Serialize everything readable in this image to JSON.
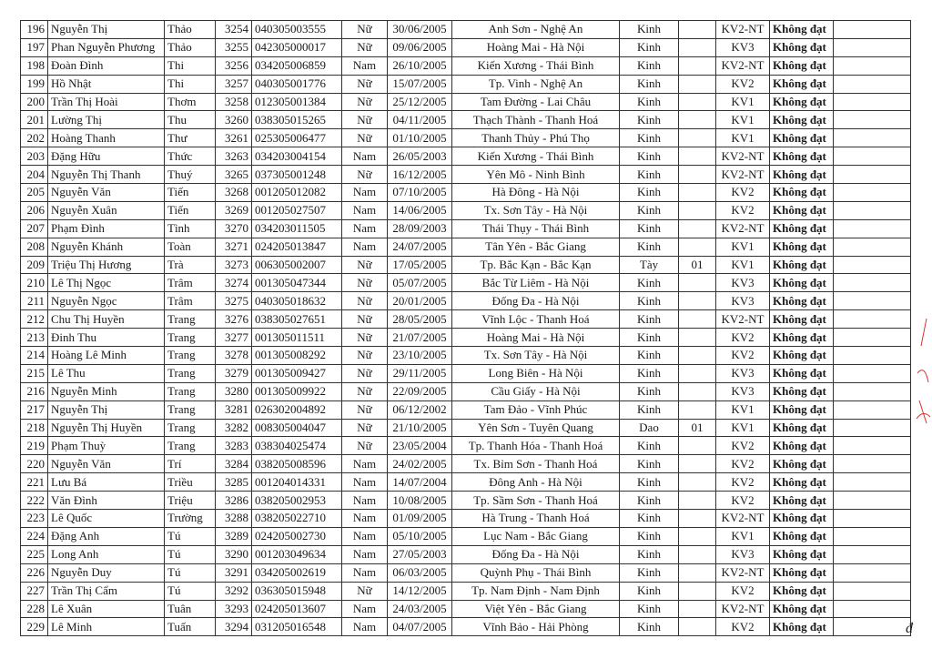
{
  "table": {
    "rows": [
      [
        "196",
        "Nguyễn Thị",
        "Thảo",
        "3254",
        "040305003555",
        "Nữ",
        "30/06/2005",
        "Anh Sơn - Nghệ An",
        "Kinh",
        "",
        "KV2-NT",
        "Không đạt",
        ""
      ],
      [
        "197",
        "Phan Nguyễn Phương",
        "Thảo",
        "3255",
        "042305000017",
        "Nữ",
        "09/06/2005",
        "Hoàng Mai - Hà Nội",
        "Kinh",
        "",
        "KV3",
        "Không đạt",
        ""
      ],
      [
        "198",
        "Đoàn Đình",
        "Thi",
        "3256",
        "034205006859",
        "Nam",
        "26/10/2005",
        "Kiến Xương - Thái Bình",
        "Kinh",
        "",
        "KV2-NT",
        "Không đạt",
        ""
      ],
      [
        "199",
        "Hồ Nhật",
        "Thi",
        "3257",
        "040305001776",
        "Nữ",
        "15/07/2005",
        "Tp. Vinh - Nghệ An",
        "Kinh",
        "",
        "KV2",
        "Không đạt",
        ""
      ],
      [
        "200",
        "Trần Thị Hoài",
        "Thơm",
        "3258",
        "012305001384",
        "Nữ",
        "25/12/2005",
        "Tam Đường - Lai Châu",
        "Kinh",
        "",
        "KV1",
        "Không đạt",
        ""
      ],
      [
        "201",
        "Lường Thị",
        "Thu",
        "3260",
        "038305015265",
        "Nữ",
        "04/11/2005",
        "Thạch Thành - Thanh Hoá",
        "Kinh",
        "",
        "KV1",
        "Không đạt",
        ""
      ],
      [
        "202",
        "Hoàng Thanh",
        "Thư",
        "3261",
        "025305006477",
        "Nữ",
        "01/10/2005",
        "Thanh Thủy - Phú Thọ",
        "Kinh",
        "",
        "KV1",
        "Không đạt",
        ""
      ],
      [
        "203",
        "Đặng Hữu",
        "Thức",
        "3263",
        "034203004154",
        "Nam",
        "26/05/2003",
        "Kiến Xương - Thái Bình",
        "Kinh",
        "",
        "KV2-NT",
        "Không đạt",
        ""
      ],
      [
        "204",
        "Nguyễn Thị Thanh",
        "Thuý",
        "3265",
        "037305001248",
        "Nữ",
        "16/12/2005",
        "Yên Mô - Ninh Bình",
        "Kinh",
        "",
        "KV2-NT",
        "Không đạt",
        ""
      ],
      [
        "205",
        "Nguyễn Văn",
        "Tiến",
        "3268",
        "001205012082",
        "Nam",
        "07/10/2005",
        "Hà Đông - Hà Nội",
        "Kinh",
        "",
        "KV2",
        "Không đạt",
        ""
      ],
      [
        "206",
        "Nguyễn Xuân",
        "Tiến",
        "3269",
        "001205027507",
        "Nam",
        "14/06/2005",
        "Tx. Sơn Tây - Hà Nội",
        "Kinh",
        "",
        "KV2",
        "Không đạt",
        ""
      ],
      [
        "207",
        "Phạm Đình",
        "Tình",
        "3270",
        "034203011505",
        "Nam",
        "28/09/2003",
        "Thái Thụy - Thái Bình",
        "Kinh",
        "",
        "KV2-NT",
        "Không đạt",
        ""
      ],
      [
        "208",
        "Nguyễn Khánh",
        "Toàn",
        "3271",
        "024205013847",
        "Nam",
        "24/07/2005",
        "Tân Yên - Bắc Giang",
        "Kinh",
        "",
        "KV1",
        "Không đạt",
        ""
      ],
      [
        "209",
        "Triệu Thị Hương",
        "Trà",
        "3273",
        "006305002007",
        "Nữ",
        "17/05/2005",
        "Tp. Bắc Kạn - Bắc Kạn",
        "Tày",
        "01",
        "KV1",
        "Không đạt",
        ""
      ],
      [
        "210",
        "Lê Thị Ngọc",
        "Trâm",
        "3274",
        "001305047344",
        "Nữ",
        "05/07/2005",
        "Bắc Từ Liêm - Hà Nội",
        "Kinh",
        "",
        "KV3",
        "Không đạt",
        ""
      ],
      [
        "211",
        "Nguyễn Ngọc",
        "Trâm",
        "3275",
        "040305018632",
        "Nữ",
        "20/01/2005",
        "Đống Đa - Hà Nội",
        "Kinh",
        "",
        "KV3",
        "Không đạt",
        ""
      ],
      [
        "212",
        "Chu Thị Huyền",
        "Trang",
        "3276",
        "038305027651",
        "Nữ",
        "28/05/2005",
        "Vĩnh Lộc - Thanh Hoá",
        "Kinh",
        "",
        "KV2-NT",
        "Không đạt",
        ""
      ],
      [
        "213",
        "Đinh Thu",
        "Trang",
        "3277",
        "001305011511",
        "Nữ",
        "21/07/2005",
        "Hoàng Mai - Hà Nội",
        "Kinh",
        "",
        "KV2",
        "Không đạt",
        ""
      ],
      [
        "214",
        "Hoàng Lê Minh",
        "Trang",
        "3278",
        "001305008292",
        "Nữ",
        "23/10/2005",
        "Tx. Sơn Tây - Hà Nội",
        "Kinh",
        "",
        "KV2",
        "Không đạt",
        ""
      ],
      [
        "215",
        "Lê Thu",
        "Trang",
        "3279",
        "001305009427",
        "Nữ",
        "29/11/2005",
        "Long Biên - Hà Nội",
        "Kinh",
        "",
        "KV3",
        "Không đạt",
        ""
      ],
      [
        "216",
        "Nguyễn Minh",
        "Trang",
        "3280",
        "001305009922",
        "Nữ",
        "22/09/2005",
        "Cầu Giấy - Hà Nội",
        "Kinh",
        "",
        "KV3",
        "Không đạt",
        ""
      ],
      [
        "217",
        "Nguyễn Thị",
        "Trang",
        "3281",
        "026302004892",
        "Nữ",
        "06/12/2002",
        "Tam Đảo - Vĩnh Phúc",
        "Kinh",
        "",
        "KV1",
        "Không đạt",
        ""
      ],
      [
        "218",
        "Nguyễn Thị Huyền",
        "Trang",
        "3282",
        "008305004047",
        "Nữ",
        "21/10/2005",
        "Yên Sơn - Tuyên Quang",
        "Dao",
        "01",
        "KV1",
        "Không đạt",
        ""
      ],
      [
        "219",
        "Phạm Thuỳ",
        "Trang",
        "3283",
        "038304025474",
        "Nữ",
        "23/05/2004",
        "Tp. Thanh Hóa - Thanh Hoá",
        "Kinh",
        "",
        "KV2",
        "Không đạt",
        ""
      ],
      [
        "220",
        "Nguyễn Văn",
        "Trí",
        "3284",
        "038205008596",
        "Nam",
        "24/02/2005",
        "Tx. Bỉm Sơn - Thanh Hoá",
        "Kinh",
        "",
        "KV2",
        "Không đạt",
        ""
      ],
      [
        "221",
        "Lưu Bá",
        "Triều",
        "3285",
        "001204014331",
        "Nam",
        "14/07/2004",
        "Đông Anh - Hà Nội",
        "Kinh",
        "",
        "KV2",
        "Không đạt",
        ""
      ],
      [
        "222",
        "Văn Đình",
        "Triệu",
        "3286",
        "038205002953",
        "Nam",
        "10/08/2005",
        "Tp.  Sầm Sơn - Thanh Hoá",
        "Kinh",
        "",
        "KV2",
        "Không đạt",
        ""
      ],
      [
        "223",
        "Lê Quốc",
        "Trường",
        "3288",
        "038205022710",
        "Nam",
        "01/09/2005",
        "Hà Trung - Thanh Hoá",
        "Kinh",
        "",
        "KV2-NT",
        "Không đạt",
        ""
      ],
      [
        "224",
        "Đặng Anh",
        "Tú",
        "3289",
        "024205002730",
        "Nam",
        "05/10/2005",
        "Lục Nam - Bắc Giang",
        "Kinh",
        "",
        "KV1",
        "Không đạt",
        ""
      ],
      [
        "225",
        "Long Anh",
        "Tú",
        "3290",
        "001203049634",
        "Nam",
        "27/05/2003",
        "Đống Đa - Hà Nội",
        "Kinh",
        "",
        "KV3",
        "Không đạt",
        ""
      ],
      [
        "226",
        "Nguyễn Duy",
        "Tú",
        "3291",
        "034205002619",
        "Nam",
        "06/03/2005",
        "Quỳnh Phụ - Thái Bình",
        "Kinh",
        "",
        "KV2-NT",
        "Không đạt",
        ""
      ],
      [
        "227",
        "Trần Thị Cẩm",
        "Tú",
        "3292",
        "036305015948",
        "Nữ",
        "14/12/2005",
        "Tp. Nam Định - Nam Định",
        "Kinh",
        "",
        "KV2",
        "Không đạt",
        ""
      ],
      [
        "228",
        "Lê Xuân",
        "Tuân",
        "3293",
        "024205013607",
        "Nam",
        "24/03/2005",
        "Việt Yên - Bắc Giang",
        "Kinh",
        "",
        "KV2-NT",
        "Không đạt",
        ""
      ],
      [
        "229",
        "Lê Minh",
        "Tuấn",
        "3294",
        "031205016548",
        "Nam",
        "04/07/2005",
        "Vĩnh Bảo - Hải Phòng",
        "Kinh",
        "",
        "KV2",
        "Không đạt",
        ""
      ]
    ]
  },
  "colors": {
    "ink": "#1a1a1a",
    "annotation": "#d9302c"
  },
  "page_mark": "đ"
}
